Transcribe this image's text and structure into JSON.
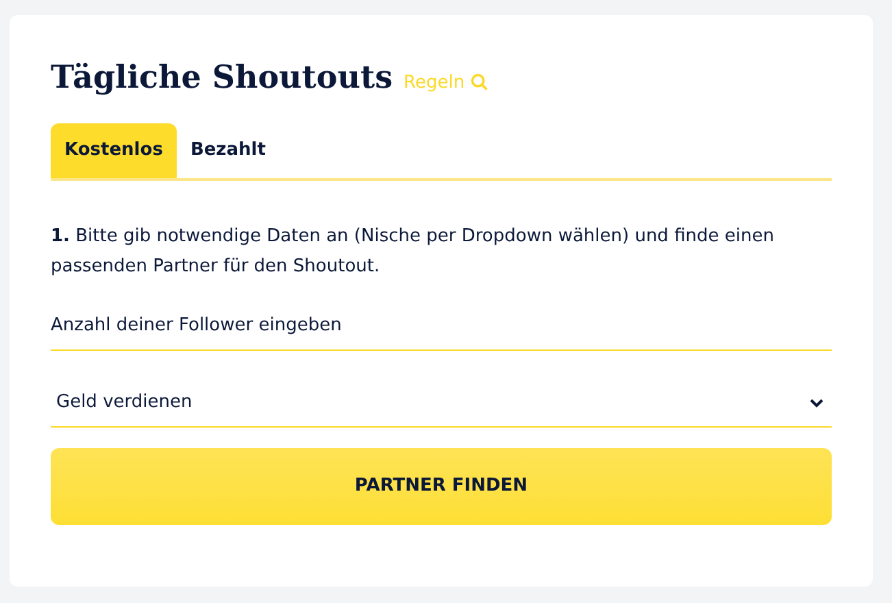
{
  "title": "Tägliche Shoutouts",
  "rules_link": "Regeln",
  "tabs": [
    {
      "label": "Kostenlos",
      "selected": true
    },
    {
      "label": "Bezahlt",
      "selected": false
    }
  ],
  "instruction": "**1.** Bitte gib notwendige Daten an (Nische per Dropdown wählen) und finde einen passenden Partner für den Shoutout.",
  "follower_field": {
    "placeholder": "Anzahl deiner Follower eingeben"
  },
  "niche_select": {
    "value": "Geld verdienen"
  },
  "submit_button": "PARTNER FINDEN"
}
